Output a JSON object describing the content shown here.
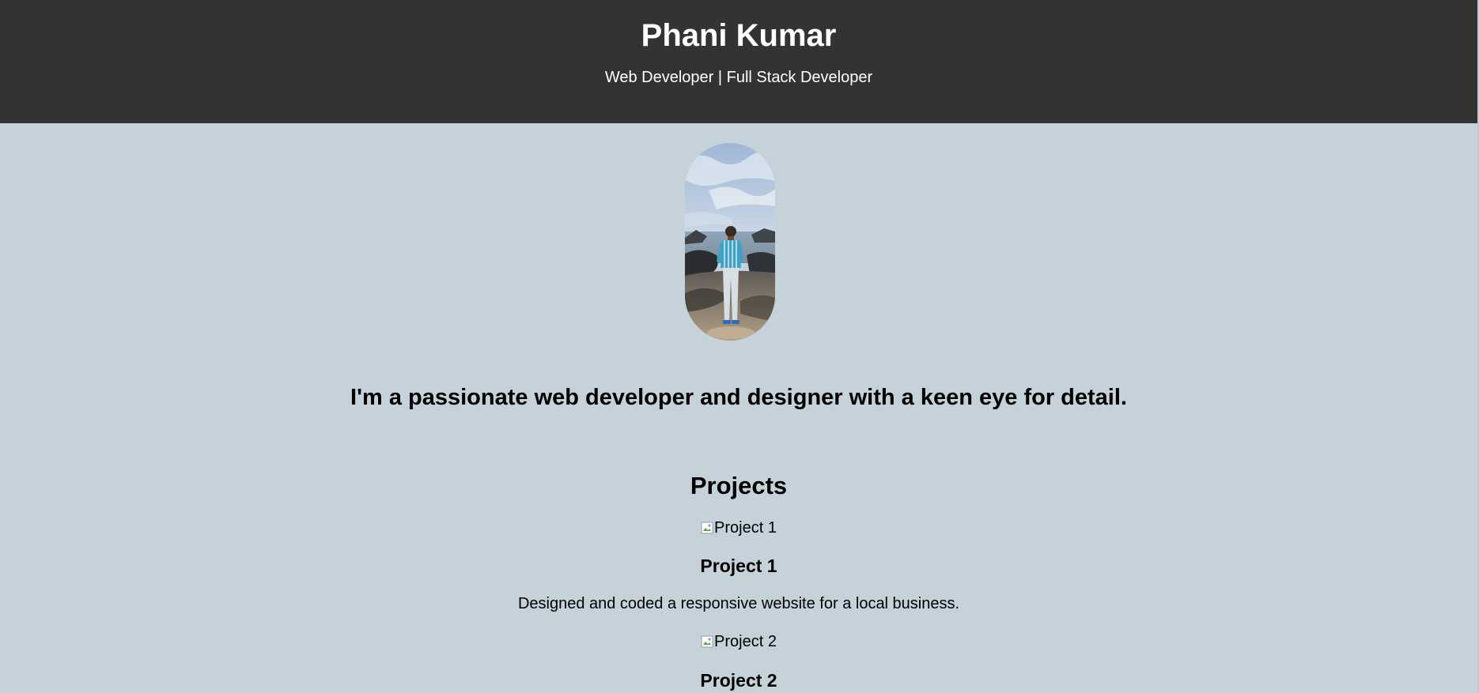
{
  "header": {
    "name": "Phani Kumar",
    "tagline": "Web Developer | Full Stack Developer"
  },
  "about": {
    "text": "I'm a passionate web developer and designer with a keen eye for detail."
  },
  "projects": {
    "heading": "Projects",
    "items": [
      {
        "img_alt": "Project 1",
        "title": "Project 1",
        "description": "Designed and coded a responsive website for a local business."
      },
      {
        "img_alt": "Project 2",
        "title": "Project 2"
      }
    ]
  },
  "colors": {
    "header_bg": "#333333",
    "page_bg": "#c5d2d9",
    "header_text": "#ffffff"
  },
  "icons": {
    "broken_image": "broken-image-icon"
  }
}
